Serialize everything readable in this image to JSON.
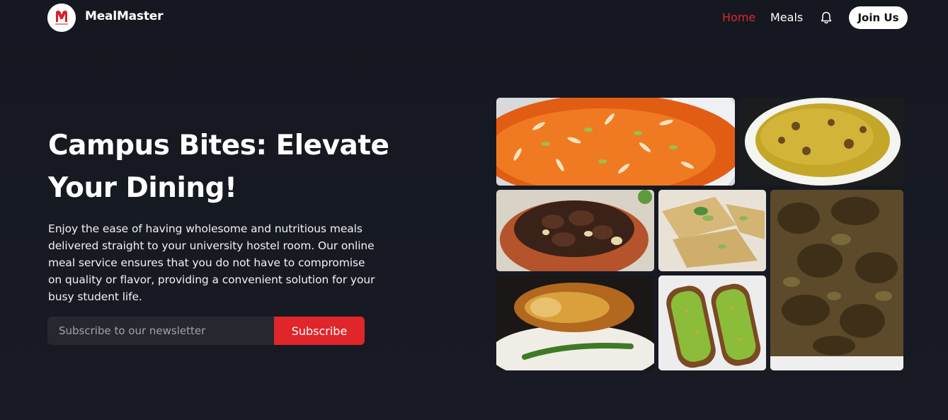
{
  "brand": {
    "name": "MealMaster",
    "logo_text": "meal master",
    "accent_color": "#e0262a"
  },
  "nav": {
    "items": [
      {
        "label": "Home",
        "active": true
      },
      {
        "label": "Meals",
        "active": false
      }
    ],
    "notification_icon": "bell-icon",
    "join_label": "Join Us"
  },
  "hero": {
    "title": "Campus Bites: Elevate Your Dining!",
    "description": "Enjoy the ease of having wholesome and nutritious meals delivered straight to your university hostel room. Our online meal service ensures that you do not have to compromise on quality or flavor, providing a convenient solution for your busy student life."
  },
  "newsletter": {
    "placeholder": "Subscribe to our newsletter",
    "value": "",
    "button_label": "Subscribe"
  },
  "gallery": {
    "images": [
      "carrot-halwa-image",
      "biryani-plate-image",
      "beef-curry-bowl-image",
      "semolina-cake-image",
      "mutton-curry-image",
      "fried-fish-rice-image",
      "avocado-toast-image"
    ]
  }
}
